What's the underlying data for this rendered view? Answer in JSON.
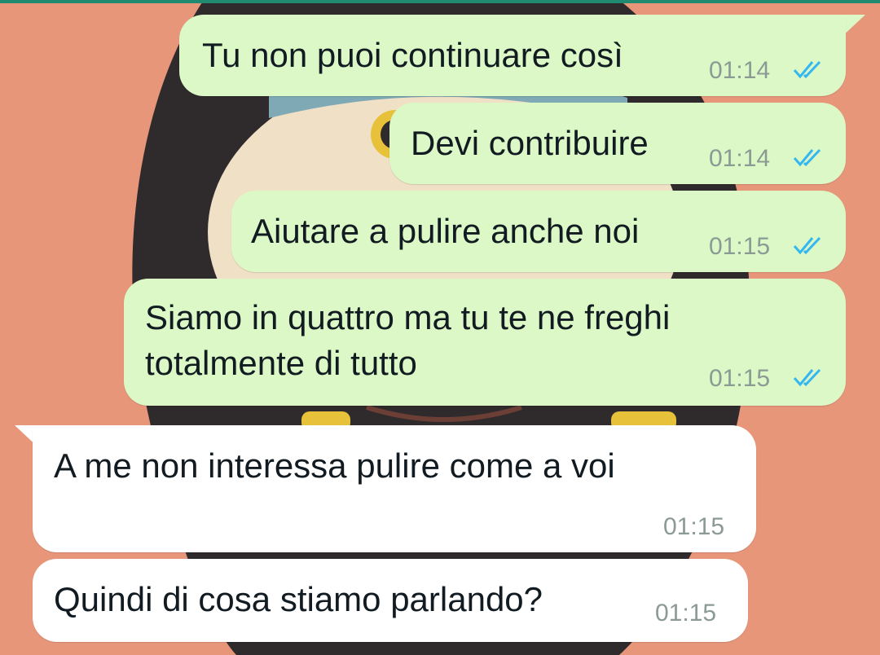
{
  "chat": {
    "messages": [
      {
        "direction": "outgoing",
        "text": "Tu non puoi continuare così",
        "time": "01:14",
        "status": "read"
      },
      {
        "direction": "outgoing",
        "text": "Devi contribuire",
        "time": "01:14",
        "status": "read"
      },
      {
        "direction": "outgoing",
        "text": "Aiutare a pulire anche noi",
        "time": "01:15",
        "status": "read"
      },
      {
        "direction": "outgoing",
        "text": "Siamo in quattro ma tu te ne freghi totalmente di tutto",
        "text_lines": [
          "Siamo in quattro ma tu te ne freghi",
          "totalmente di tutto"
        ],
        "time": "01:15",
        "status": "read"
      },
      {
        "direction": "incoming",
        "text": "A me non interessa pulire come a voi",
        "time": "01:15"
      },
      {
        "direction": "incoming",
        "text": "Quindi di cosa stiamo parlando?",
        "time": "01:15"
      }
    ]
  },
  "colors": {
    "wallpaper": "#e8967a",
    "outgoing_bubble": "#dcf8c6",
    "incoming_bubble": "#ffffff",
    "read_tick": "#34b7f1",
    "timestamp": "#8b9a94",
    "text": "#111b21"
  },
  "icons": {
    "read_status": "double-check-icon"
  }
}
